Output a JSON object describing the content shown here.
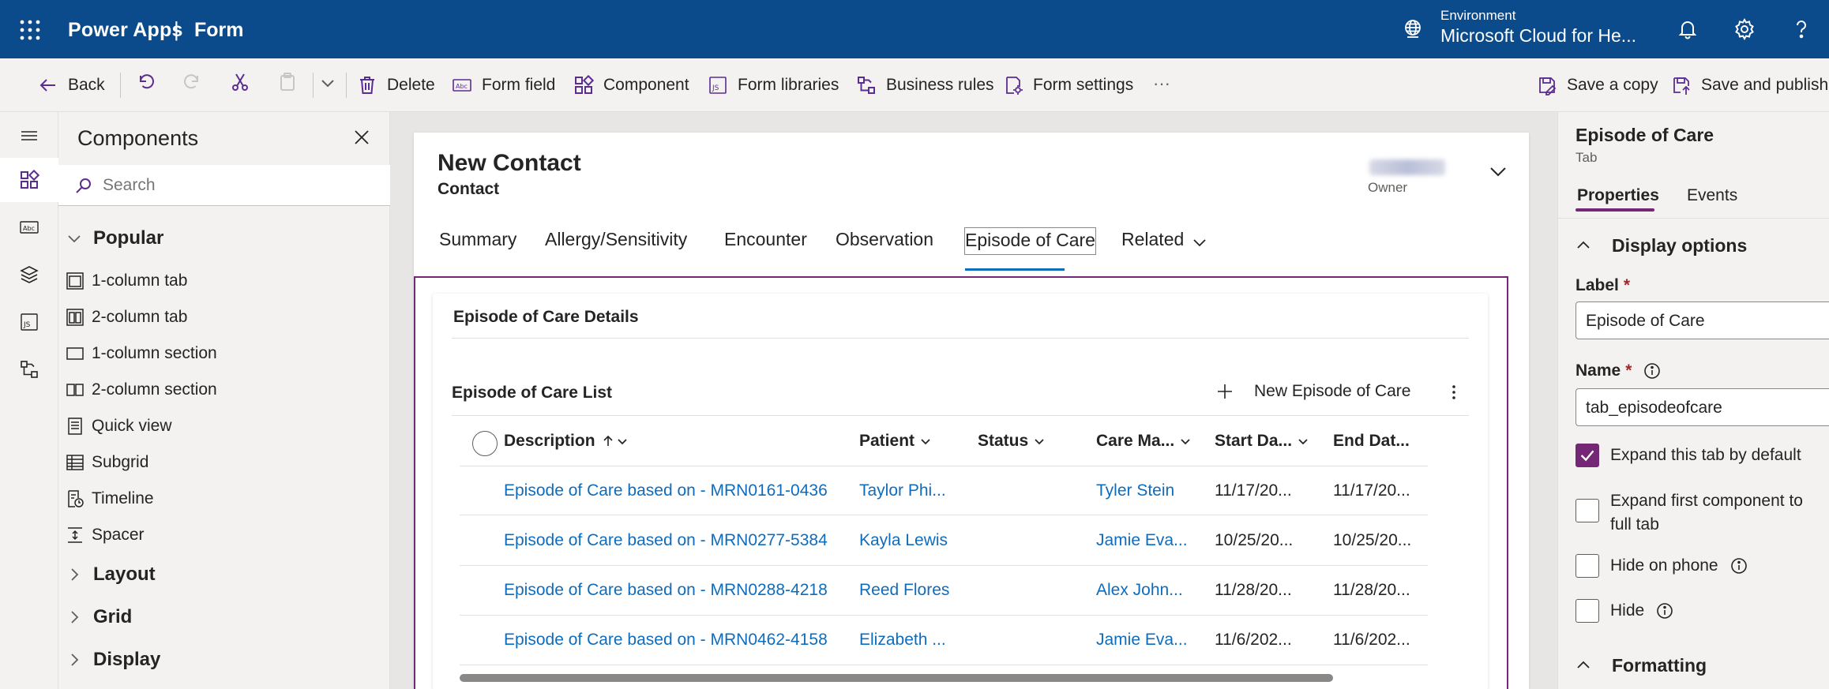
{
  "header": {
    "app_name": "Power Apps",
    "separator": "|",
    "app_sub": "Form",
    "env_label": "Environment",
    "env_value": "Microsoft Cloud for He..."
  },
  "commands": {
    "back": "Back",
    "delete": "Delete",
    "form_field": "Form field",
    "component": "Component",
    "form_libraries": "Form libraries",
    "business_rules": "Business rules",
    "form_settings": "Form settings",
    "more": "···",
    "save_copy": "Save a copy",
    "save_publish": "Save and publish"
  },
  "components": {
    "title": "Components",
    "search_placeholder": "Search",
    "groups": {
      "popular": "Popular",
      "layout": "Layout",
      "grid": "Grid",
      "display": "Display"
    },
    "items": [
      "1-column tab",
      "2-column tab",
      "1-column section",
      "2-column section",
      "Quick view",
      "Subgrid",
      "Timeline",
      "Spacer"
    ]
  },
  "form": {
    "title": "New Contact",
    "subtitle": "Contact",
    "owner_label": "Owner",
    "tabs": [
      "Summary",
      "Allergy/Sensitivity",
      "Encounter",
      "Observation",
      "Episode of Care",
      "Related"
    ],
    "section_title": "Episode of Care Details",
    "grid_title": "Episode of Care List",
    "new_button": "New Episode of Care",
    "columns": [
      "Description",
      "Patient",
      "Status",
      "Care Ma...",
      "Start Da...",
      "End Dat..."
    ],
    "rows": [
      {
        "description": "Episode of Care based on - MRN0161-0436",
        "patient": "Taylor Phi...",
        "status": "",
        "care_manager": "Tyler Stein",
        "start": "11/17/20...",
        "end": "11/17/20..."
      },
      {
        "description": "Episode of Care based on - MRN0277-5384",
        "patient": "Kayla Lewis",
        "status": "",
        "care_manager": "Jamie Eva...",
        "start": "10/25/20...",
        "end": "10/25/20..."
      },
      {
        "description": "Episode of Care based on - MRN0288-4218",
        "patient": "Reed Flores",
        "status": "",
        "care_manager": "Alex John...",
        "start": "11/28/20...",
        "end": "11/28/20..."
      },
      {
        "description": "Episode of Care based on - MRN0462-4158",
        "patient": "Elizabeth ...",
        "status": "",
        "care_manager": "Jamie Eva...",
        "start": "11/6/202...",
        "end": "11/6/202..."
      }
    ]
  },
  "properties": {
    "title": "Episode of Care",
    "subtitle": "Tab",
    "tab_properties": "Properties",
    "tab_events": "Events",
    "display_options": "Display options",
    "label_label": "Label",
    "label_value": "Episode of Care",
    "name_label": "Name",
    "name_value": "tab_episodeofcare",
    "required_mark": "*",
    "expand_default": "Expand this tab by default",
    "expand_first": "Expand first component to full tab",
    "hide_phone": "Hide on phone",
    "hide": "Hide",
    "formatting": "Formatting"
  },
  "colors": {
    "header_bg": "#0b4a8b",
    "accent_purple": "#742774",
    "link_blue": "#0f6cbd"
  },
  "icons": [
    "waffle-icon",
    "globe-icon",
    "bell-icon",
    "gear-icon",
    "help-icon",
    "back-arrow-icon",
    "undo-icon",
    "redo-icon",
    "cut-icon",
    "paste-icon",
    "chevron-down-icon",
    "delete-icon",
    "form-field-icon",
    "component-icon",
    "form-libraries-icon",
    "business-rules-icon",
    "form-settings-icon",
    "save-copy-icon",
    "save-publish-icon",
    "close-icon",
    "search-icon",
    "info-icon",
    "plus-icon",
    "more-vertical-icon"
  ]
}
